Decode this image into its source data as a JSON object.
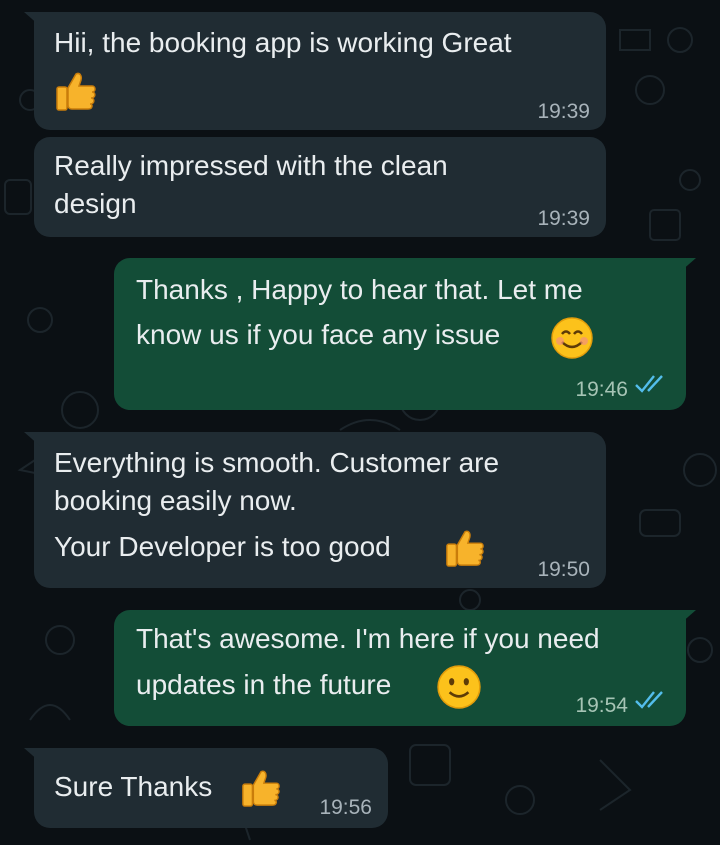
{
  "messages": [
    {
      "direction": "incoming",
      "lines": [
        "Hii,  the booking app is working Great"
      ],
      "emoji": "thumbs-up",
      "time": "19:39"
    },
    {
      "direction": "incoming",
      "lines": [
        "Really impressed with the clean",
        "design"
      ],
      "time": "19:39"
    },
    {
      "direction": "outgoing",
      "lines": [
        "Thanks , Happy to hear that. Let me",
        "know us if you face any issue"
      ],
      "emoji": "smiling-face",
      "time": "19:46",
      "status": "read"
    },
    {
      "direction": "incoming",
      "lines": [
        "Everything is smooth. Customer are",
        "booking easily now.",
        "Your Developer is too good"
      ],
      "emoji": "thumbs-up",
      "time": "19:50"
    },
    {
      "direction": "outgoing",
      "lines": [
        "That's awesome. I'm here if you need",
        "updates in the future"
      ],
      "emoji": "slightly-smiling-face",
      "time": "19:54",
      "status": "read"
    },
    {
      "direction": "incoming",
      "lines": [
        "Sure Thanks"
      ],
      "emoji": "thumbs-up",
      "time": "19:56"
    }
  ],
  "colors": {
    "background": "#0b1014",
    "incoming_bubble": "#202c33",
    "outgoing_bubble": "#134d37",
    "read_ticks": "#53bdeb"
  }
}
